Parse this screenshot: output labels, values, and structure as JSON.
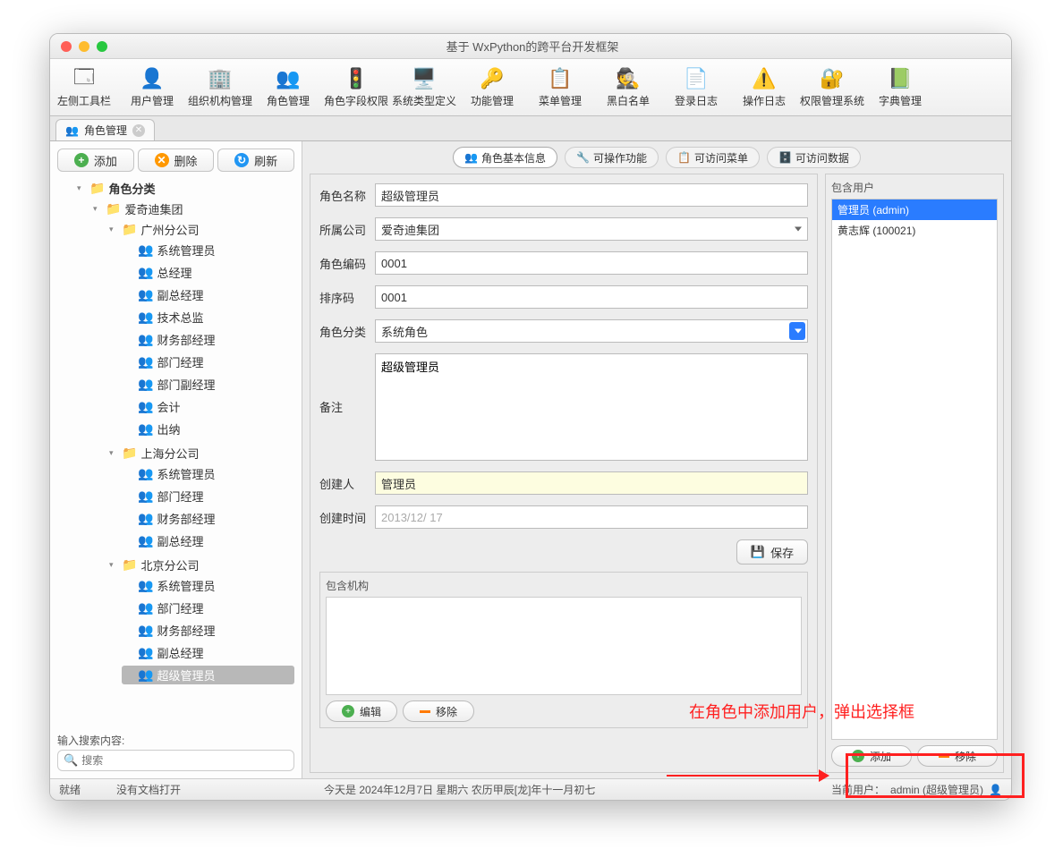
{
  "window": {
    "title": "基于 WxPython的跨平台开发框架"
  },
  "toolbar": [
    {
      "label": "左侧工具栏",
      "icon": "🗔"
    },
    {
      "label": "用户管理",
      "icon": "👤"
    },
    {
      "label": "组织机构管理",
      "icon": "🏢"
    },
    {
      "label": "角色管理",
      "icon": "👥"
    },
    {
      "label": "角色字段权限",
      "icon": "🚦"
    },
    {
      "label": "系统类型定义",
      "icon": "🖥️"
    },
    {
      "label": "功能管理",
      "icon": "🔑"
    },
    {
      "label": "菜单管理",
      "icon": "📋"
    },
    {
      "label": "黑白名单",
      "icon": "🕵️"
    },
    {
      "label": "登录日志",
      "icon": "📄"
    },
    {
      "label": "操作日志",
      "icon": "⚠️"
    },
    {
      "label": "权限管理系统",
      "icon": "🔐"
    },
    {
      "label": "字典管理",
      "icon": "📗"
    }
  ],
  "tab": {
    "label": "角色管理"
  },
  "buttons": {
    "add": "添加",
    "delete": "删除",
    "refresh": "刷新"
  },
  "tree": {
    "root": "角色分类",
    "org": "爱奇迪集团",
    "branches": [
      {
        "name": "广州分公司",
        "roles": [
          "系统管理员",
          "总经理",
          "副总经理",
          "技术总监",
          "财务部经理",
          "部门经理",
          "部门副经理",
          "会计",
          "出纳"
        ]
      },
      {
        "name": "上海分公司",
        "roles": [
          "系统管理员",
          "部门经理",
          "财务部经理",
          "副总经理"
        ]
      },
      {
        "name": "北京分公司",
        "roles": [
          "系统管理员",
          "部门经理",
          "财务部经理",
          "副总经理",
          "超级管理员"
        ]
      }
    ]
  },
  "search": {
    "label": "输入搜索内容:",
    "placeholder": "搜索"
  },
  "subtabs": [
    "角色基本信息",
    "可操作功能",
    "可访问菜单",
    "可访问数据"
  ],
  "form": {
    "role_name": {
      "label": "角色名称",
      "value": "超级管理员"
    },
    "company": {
      "label": "所属公司",
      "value": "爱奇迪集团"
    },
    "role_code": {
      "label": "角色编码",
      "value": "0001"
    },
    "sort_code": {
      "label": "排序码",
      "value": "0001"
    },
    "role_type": {
      "label": "角色分类",
      "value": "系统角色"
    },
    "remark": {
      "label": "备注",
      "value": "超级管理员"
    },
    "creator": {
      "label": "创建人",
      "value": "管理员"
    },
    "create_time": {
      "label": "创建时间",
      "value": "2013/12/ 17"
    },
    "save": "保存"
  },
  "orgbox": {
    "label": "包含机构",
    "edit": "编辑",
    "remove": "移除"
  },
  "userbox": {
    "label": "包含用户",
    "users": [
      "管理员 (admin)",
      "黄志辉 (100021)"
    ],
    "add": "添加",
    "remove": "移除"
  },
  "annotation": "在角色中添加用户，弹出选择框",
  "status": {
    "ready": "就绪",
    "doc": "没有文档打开",
    "date": "今天是 2024年12月7日 星期六 农历甲辰[龙]年十一月初七",
    "user_label": "当前用户：",
    "user": "admin (超级管理员)"
  }
}
